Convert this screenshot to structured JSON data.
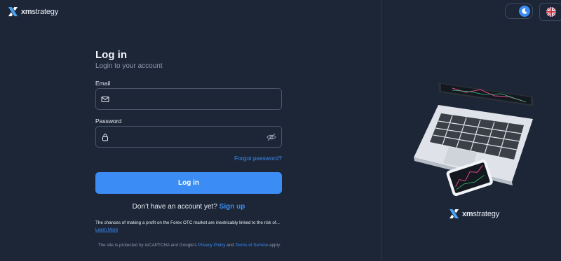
{
  "brand": {
    "name_prefix": "xm",
    "name_suffix": "strategy"
  },
  "header": {
    "theme_toggle_icon": "moon-icon",
    "language_icon": "uk-flag-icon"
  },
  "form": {
    "title": "Log in",
    "subtitle": "Login to your account",
    "email_label": "Email",
    "email_value": "",
    "email_placeholder": "",
    "password_label": "Password",
    "password_value": "",
    "password_placeholder": "",
    "forgot_password": "Forgot password?",
    "submit_label": "Log in",
    "no_account_text": "Don’t have an account yet?",
    "signup_link": "Sign up"
  },
  "disclaimer": {
    "risk_text": "The chances of making a profit on the Forex OTC market are inextricably linked to the risk of...",
    "learn_more": "Learn More",
    "recaptcha_prefix": "The site is protected by reCAPTCHA and Google’s",
    "privacy_policy": "Privacy Policy",
    "and": "and",
    "terms_of_service": "Terms of Service",
    "apply": "apply."
  },
  "colors": {
    "background": "#1c2637",
    "accent": "#3b8cf4",
    "border": "#4a5568"
  }
}
